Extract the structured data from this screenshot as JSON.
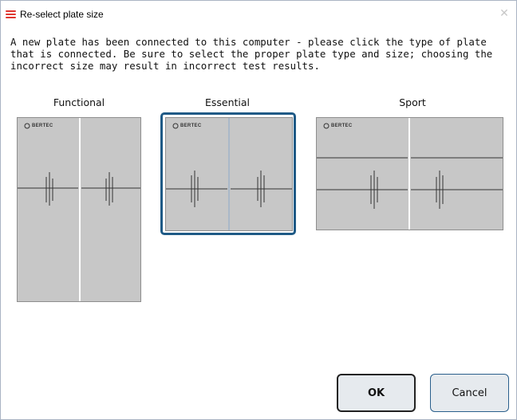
{
  "window": {
    "title": "Re-select plate size",
    "close_glyph": "✕"
  },
  "message": "A new plate has been connected to this computer - please click the type of plate that is connected. Be sure to select the proper plate type and size; choosing the incorrect size may result in incorrect test results.",
  "plates": [
    {
      "label": "Functional",
      "logo": "BERTEC",
      "selected": false
    },
    {
      "label": "Essential",
      "logo": "BERTEC",
      "selected": true
    },
    {
      "label": "Sport",
      "logo": "BERTEC",
      "selected": false
    }
  ],
  "buttons": {
    "ok": "OK",
    "cancel": "Cancel"
  },
  "colors": {
    "selected_border": "#1f5a86",
    "plate_fill": "#c7c7c7",
    "app_icon": "#e0362f"
  }
}
